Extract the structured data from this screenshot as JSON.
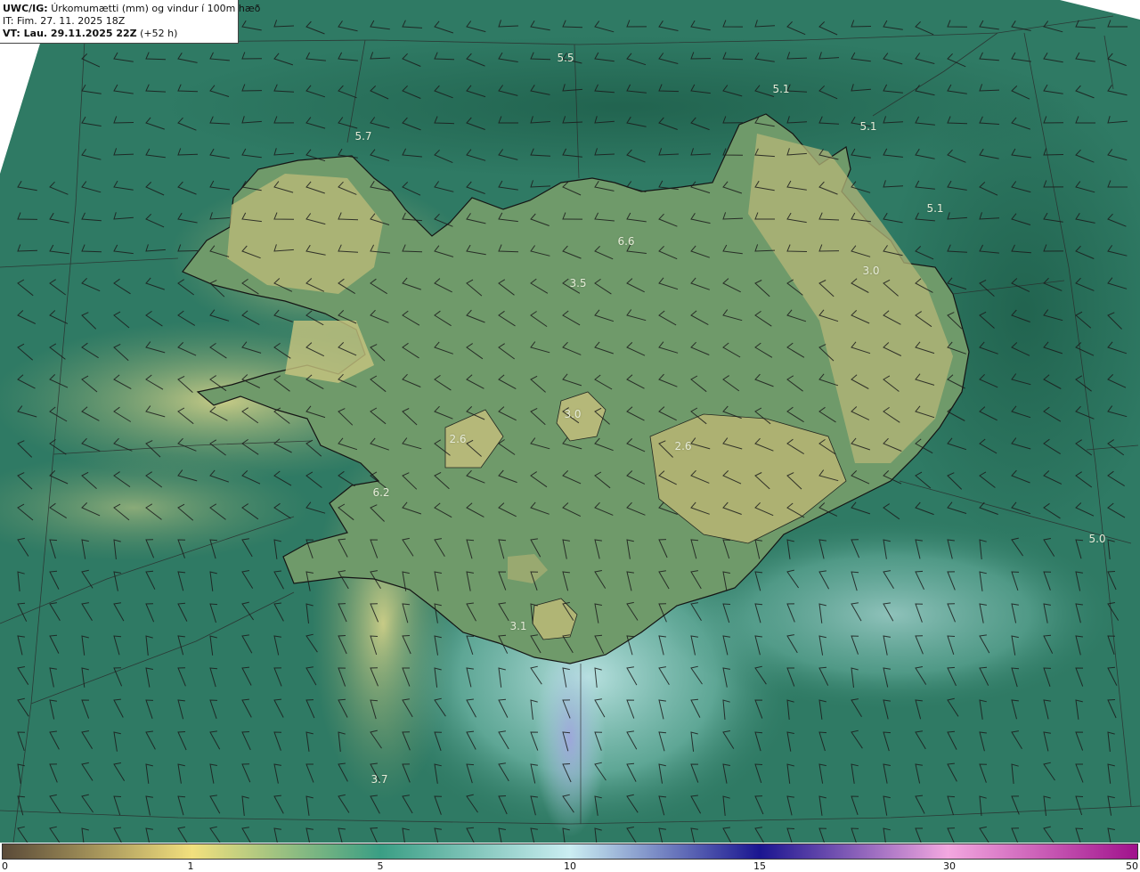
{
  "header": {
    "product_prefix": "UWC/IG:",
    "product_title": "Úrkomumætti (mm) og vindur í 100m hæð",
    "it_line": "IT: Fim. 27. 11. 2025 18Z",
    "vt_prefix": "VT: Lau. 29.11.2025 22Z",
    "vt_suffix": "(+52 h)"
  },
  "map_labels": [
    {
      "text": "5.5"
    },
    {
      "text": "5.1"
    },
    {
      "text": "5.7"
    },
    {
      "text": "5.1"
    },
    {
      "text": "5.1"
    },
    {
      "text": "6.6"
    },
    {
      "text": "3.5"
    },
    {
      "text": "3.0"
    },
    {
      "text": "3.0"
    },
    {
      "text": "2.6"
    },
    {
      "text": "2.6"
    },
    {
      "text": "6.2"
    },
    {
      "text": "5.0"
    },
    {
      "text": "3.1"
    },
    {
      "text": "3.7"
    }
  ],
  "color_scale": {
    "ticks": [
      "0",
      "1",
      "5",
      "10",
      "15",
      "30",
      "50"
    ],
    "stops": [
      "#5a4a38",
      "#f2e07e",
      "#3a9e84",
      "#cbeef2",
      "#1a1590",
      "#f3a8e0",
      "#a0128c"
    ]
  },
  "colors": {
    "ocean": "#2f7a64",
    "land": "#b8bd78",
    "coast": "#141414"
  }
}
